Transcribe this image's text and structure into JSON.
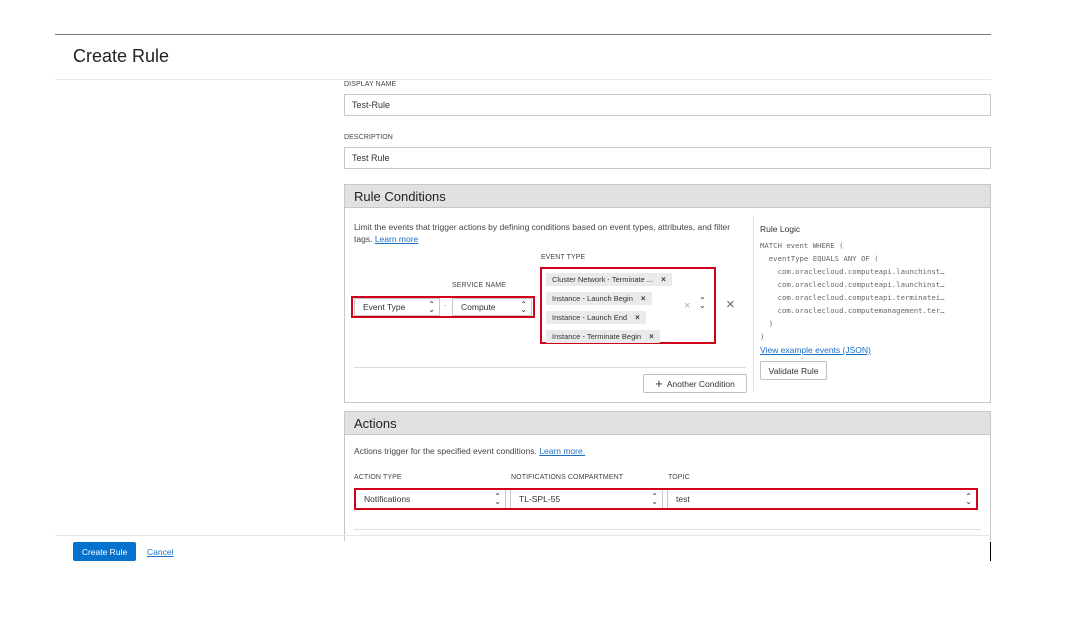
{
  "page": {
    "title": "Create Rule"
  },
  "form": {
    "display_name_label": "DISPLAY NAME",
    "display_name_value": "Test-Rule",
    "description_label": "DESCRIPTION",
    "description_value": "Test Rule"
  },
  "rule_conditions": {
    "title": "Rule Conditions",
    "help_text": "Limit the events that trigger actions by defining conditions based on event types, attributes, and filter tags.",
    "learn_more": "Learn more",
    "condition_type": "Event Type",
    "service_name_label": "SERVICE NAME",
    "service_name": "Compute",
    "event_type_label": "EVENT TYPE",
    "event_types": [
      "Cluster Network - Terminate ...",
      "Instance - Launch Begin",
      "Instance - Launch End",
      "Instance - Terminate Begin"
    ],
    "another_condition": "Another Condition",
    "rule_logic_title": "Rule Logic",
    "rule_logic_lines": [
      "MATCH event WHERE (",
      "  eventType EQUALS ANY OF (",
      "    com.oraclecloud.computeapi.launchinst…",
      "    com.oraclecloud.computeapi.launchinst…",
      "    com.oraclecloud.computeapi.terminatei…",
      "    com.oraclecloud.computemanagement.ter…",
      "  )",
      ")"
    ],
    "view_example": "View example events (JSON)",
    "validate_rule": "Validate Rule"
  },
  "actions": {
    "title": "Actions",
    "help_text": "Actions trigger for the specified event conditions.",
    "learn_more": "Learn more.",
    "action_type_label": "ACTION TYPE",
    "action_type": "Notifications",
    "compartment_label": "NOTIFICATIONS COMPARTMENT",
    "compartment": "TL-SPL-55",
    "topic_label": "TOPIC",
    "topic": "test"
  },
  "footer": {
    "create_rule": "Create Rule",
    "cancel": "Cancel"
  },
  "colors": {
    "highlight": "#d0021b",
    "primary": "#0572ce",
    "panel_header": "#dfe1e3"
  }
}
